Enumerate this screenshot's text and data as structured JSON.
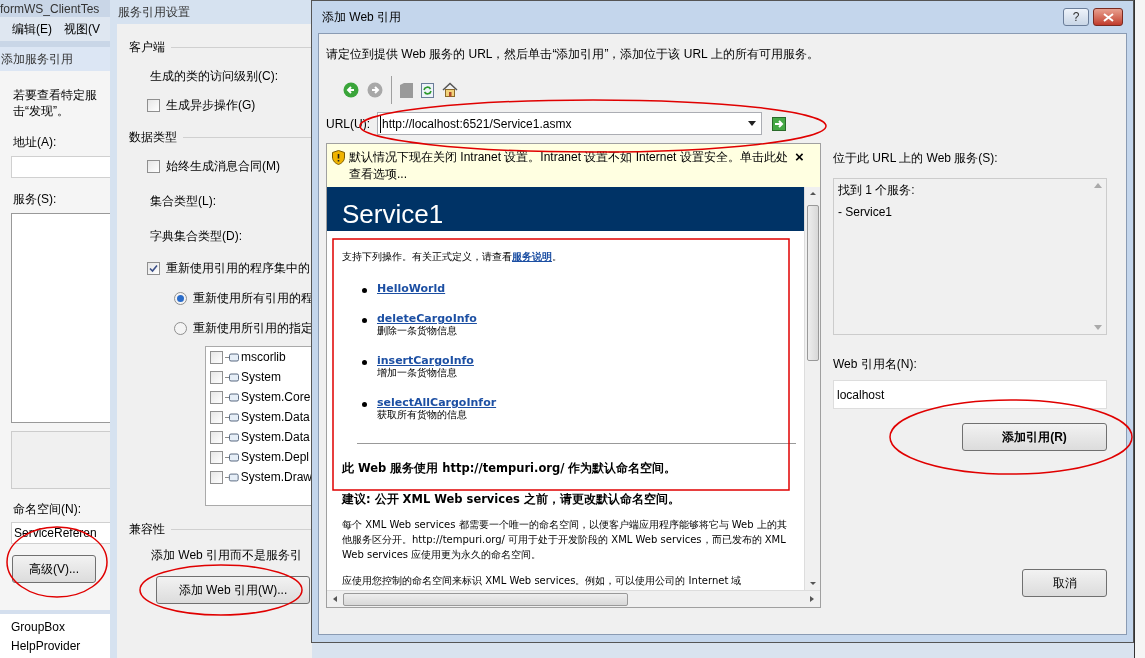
{
  "background_window": {
    "title": "formWS_ClientTes",
    "menu": [
      "编辑(E)",
      "视图(V"
    ],
    "panel_title": "添加服务引用",
    "intro_lines": [
      "若要查看特定服",
      "击“发现”。"
    ],
    "address_label": "地址(A):",
    "services_label": "服务(S):",
    "namespace_label": "命名空间(N):",
    "namespace_value": "ServiceReferen",
    "advanced_button": "高级(V)...",
    "toolbox_items": [
      "GroupBox",
      "HelpProvider"
    ]
  },
  "settings_window": {
    "title": "服务引用设置",
    "client_heading": "客户端",
    "access_label": "生成的类的访问级别(C):",
    "async_checkbox": {
      "label": "生成异步操作(G)",
      "checked": false
    },
    "datatypes_heading": "数据类型",
    "contracts_checkbox": {
      "label": "始终生成消息合同(M)",
      "checked": false
    },
    "collection_label": "集合类型(L):",
    "dictionary_label": "字典集合类型(D):",
    "reuse_checkbox": {
      "label": "重新使用引用的程序集中的",
      "checked": true
    },
    "reuse_options": [
      {
        "label": "重新使用所有引用的程",
        "selected": true
      },
      {
        "label": "重新使用所引用的指定",
        "selected": false
      }
    ],
    "assemblies": [
      {
        "name": "mscorlib",
        "checked": false
      },
      {
        "name": "System",
        "checked": false
      },
      {
        "name": "System.Core",
        "checked": false
      },
      {
        "name": "System.Data",
        "checked": false
      },
      {
        "name": "System.Data",
        "checked": false
      },
      {
        "name": "System.Depl",
        "checked": false
      },
      {
        "name": "System.Draw",
        "checked": false
      }
    ],
    "compat_heading": "兼容性",
    "compat_text": "添加 Web 引用而不是服务引",
    "web_reference_button": "添加 Web 引用(W)..."
  },
  "dialog": {
    "title": "添加 Web 引用",
    "help_button": "?",
    "instructions": "请定位到提供 Web 服务的 URL，然后单击“添加引用”，添加位于该 URL 上的所有可用服务。",
    "url_label": "URL(U):",
    "url_value": "http://localhost:6521/Service1.asmx",
    "infobar": {
      "text": "默认情况下现在关闭 Intranet 设置。Intranet 设置不如 Internet 设置安全。单击此处查看选项...",
      "close": "×"
    },
    "page": {
      "heading": "Service1",
      "intro": "支持下列操作。有关正式定义，请查看",
      "intro_link": "服务说明",
      "intro_end": "。",
      "operations": [
        {
          "name": "HelloWorld"
        },
        {
          "name": "deleteCargoInfo",
          "description": "删除一条货物信息"
        },
        {
          "name": "insertCargoInfo",
          "description": "增加一条货物信息"
        },
        {
          "name": "selectAllCargoInfor",
          "description": "获取所有货物的信息"
        }
      ],
      "namespace_note": "此 Web 服务使用 http://tempuri.org/ 作为默认命名空间。",
      "recommendation": "建议: 公开 XML Web services 之前，请更改默认命名空间。",
      "paragraphs": [
        "每个 XML Web services 都需要一个唯一的命名空间，以便客户端应用程序能够将它与 Web 上的其他服务区分开。http://tempuri.org/ 可用于处于开发阶段的 XML Web services，而已发布的 XML Web services 应使用更为永久的命名空间。",
        "应使用您控制的命名空间来标识 XML Web services。例如，可以使用公司的 Internet 域"
      ]
    },
    "services_label": "位于此 URL 上的 Web 服务(S):",
    "services_lines": [
      "找到 1 个服务:",
      "- Service1"
    ],
    "reference_name_label": "Web 引用名(N):",
    "reference_name_value": "localhost",
    "add_reference_button": "添加引用(R)",
    "cancel_button": "取消"
  }
}
